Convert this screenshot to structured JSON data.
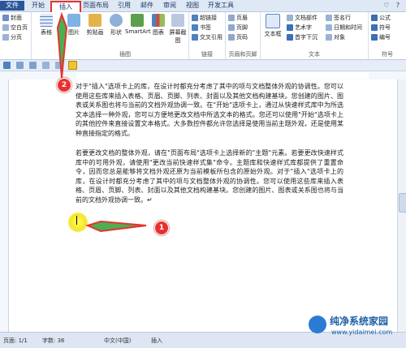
{
  "tabs": [
    "文件",
    "开始",
    "插入",
    "页面布局",
    "引用",
    "邮件",
    "审阅",
    "视图",
    "开发工具"
  ],
  "active_tab": "插入",
  "help_icons": [
    "♡",
    "?"
  ],
  "ribbon": {
    "pages_group": {
      "items": [
        "封面",
        "空白页",
        "分页"
      ]
    },
    "table_group": {
      "label": "表格"
    },
    "illustrations": {
      "label": "插图",
      "buttons": [
        "图片",
        "剪贴画",
        "形状",
        "SmartArt",
        "图表",
        "屏幕截图"
      ]
    },
    "links": {
      "label": "链接",
      "items": [
        "超链接",
        "书签",
        "交叉引用"
      ]
    },
    "header_footer": {
      "label": "页眉和页脚",
      "items": [
        "页眉",
        "页脚",
        "页码"
      ]
    },
    "text": {
      "label": "文本",
      "textbox": "文本框",
      "items": [
        "文档部件",
        "艺术字",
        "首字下沉",
        "签名行",
        "日期和时间",
        "对象"
      ]
    },
    "symbols": {
      "label": "符号",
      "items": [
        "公式",
        "符号",
        "编号"
      ]
    }
  },
  "document": {
    "paragraphs": [
      "对于\"插入\"选项卡上的库，在设计时都充分考虑了其中的项与文档整体外观的协调性。您可以使用这些库来插入表格、页眉、页脚、列表、封面以及其他文档构建基块。您创建的图片、图表或关系图也将与当前的文档外观协调一致。在\"开始\"选项卡上，通过从快速样式库中为所选文本选择一种外观，您可以方便地更改文档中所选文本的格式。您还可以使用\"开始\"选项卡上的其他控件来直接设置文本格式。大多数控件都允许您选择是使用当前主题外观，还是使用某种直接指定的格式。",
      "若要更改文档的整体外观，请在\"页面布局\"选项卡上选择新的\"主题\"元素。若要更改快速样式库中的可用外观，请使用\"更改当前快速样式集\"命令。主题库和快速样式库都提供了重置命令，因而您总是能够将文档外观还原为当前模板所包含的原始外观。对于\"插入\"选项卡上的库，在设计时都充分考虑了其中的项与文档整体外观的协调性。您可以使用这些库来插入表格、页眉、页脚、列表、封面以及其他文档构建基块。您创建的图片、图表或关系图也将与当前的文档外观协调一致。↵"
    ]
  },
  "callouts": [
    "1",
    "2"
  ],
  "status": {
    "page": "页面: 1/1",
    "words": "字数: 36",
    "lang": "中文(中国)",
    "mode": "插入"
  },
  "watermark": {
    "title": "纯净系统家园",
    "url": "www.yidaimei.com"
  }
}
